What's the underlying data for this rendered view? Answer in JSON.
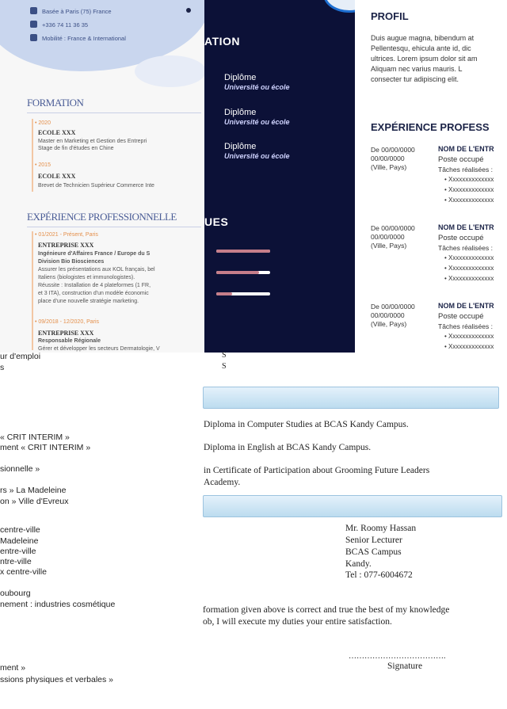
{
  "left_cv": {
    "contacts": [
      "Basée à Paris (75) France",
      "+336 74 11 36 35",
      "Mobilité : France & International"
    ],
    "formation_title": "FORMATION",
    "formation": [
      {
        "date": "• 2020",
        "school": "ECOLE XXX",
        "lines": [
          "Master en Marketing et Gestion des Entrepri",
          "Stage de fin d'études en Chine"
        ]
      },
      {
        "date": "• 2015",
        "school": "ECOLE XXX",
        "lines": [
          "Brevet de Technicien Supérieur Commerce Inte"
        ]
      }
    ],
    "experience_title": "EXPÉRIENCE PROFESSIONNELLE",
    "experience": [
      {
        "date": "• 01/2021 - Présent, Paris",
        "company": "ENTREPRISE XXX",
        "role": "Ingénieure d'Affaires France / Europe du S",
        "lines": [
          "Division Bio Biosciences",
          "Assurer les présentations aux KOL français, bel",
          "Italiens (biologistes et immunologistes).",
          "Réussite : Installation de 4 plateformes (1 FR,",
          "et 3 ITA), construction d'un modèle économic",
          "place d'une nouvelle stratégie marketing."
        ]
      },
      {
        "date": "• 09/2018 - 12/2020, Paris",
        "company": "ENTREPRISE XXX",
        "role": "Responsable Régionale",
        "lines": [
          "Gérer et développer les secteurs Dermatologie, V"
        ]
      }
    ]
  },
  "dark_panel": {
    "formation_title": "ATION",
    "diplomas": [
      {
        "title": "Diplôme",
        "school": "Université ou école"
      },
      {
        "title": "Diplôme",
        "school": "Université ou école"
      },
      {
        "title": "Diplôme",
        "school": "Université ou école"
      }
    ],
    "skills_title": "UES",
    "skill_levels": [
      1.0,
      0.8,
      0.3
    ]
  },
  "right_cv": {
    "profil_title": "PROFIL",
    "profil_lines": [
      "Duis augue magna, bibendum at",
      "Pellentesqu, ehicula ante id, dic",
      "ultrices. Lorem ipsum dolor sit am",
      "Aliquam nec varius mauris. L",
      "consecter tur adipiscing elit."
    ],
    "experience_title": "EXPÉRIENCE PROFESS",
    "jobs": [
      {
        "dates": [
          "De 00/00/0000",
          "00/00/0000",
          "(Ville, Pays)"
        ],
        "company": "NOM DE L'ENTR",
        "post": "Poste occupé",
        "tasks": "Tâches réalisées :",
        "bullets": [
          "• Xxxxxxxxxxxxxx",
          "• Xxxxxxxxxxxxxx",
          "• Xxxxxxxxxxxxxx"
        ]
      },
      {
        "dates": [
          "De 00/00/0000",
          "00/00/0000",
          "(Ville, Pays)"
        ],
        "company": "NOM DE L'ENTR",
        "post": "Poste occupé",
        "tasks": "Tâches réalisées :",
        "bullets": [
          "• Xxxxxxxxxxxxxx",
          "• Xxxxxxxxxxxxxx",
          "• Xxxxxxxxxxxxxx"
        ]
      },
      {
        "dates": [
          "De 00/00/0000",
          "00/00/0000",
          "(Ville, Pays)"
        ],
        "company": "NOM DE L'ENTR",
        "post": "Poste occupé",
        "tasks": "Tâches réalisées :",
        "bullets": [
          "• Xxxxxxxxxxxxxx",
          "• Xxxxxxxxxxxxxx"
        ]
      }
    ]
  },
  "bottom_left": {
    "lines": [
      "ur d'emploi",
      "s",
      "« CRIT INTERIM »",
      "ment « CRIT INTERIM »",
      "sionnelle »",
      "rs » La Madeleine",
      "on » Ville d'Evreux",
      "centre-ville",
      "Madeleine",
      "entre-ville",
      "ntre-ville",
      "x centre-ville",
      "oubourg",
      "nement : industries cosmétique",
      "ment »",
      "ssions physiques et verbales »"
    ]
  },
  "bottom_mid": {
    "s_letters": [
      "S",
      "S"
    ],
    "education": [
      "Diploma in Computer Studies at BCAS Kandy Campus.",
      "Diploma in English at BCAS Kandy Campus.",
      "in Certificate of Participation about Grooming Future Leaders",
      "Academy."
    ],
    "referee": [
      "Mr. Roomy Hassan",
      "Senior Lecturer",
      "BCAS  Campus",
      "Kandy.",
      "Tel : 077-6004672"
    ],
    "declaration": [
      "formation given above is correct and true the best of my knowledge",
      "ob, I will execute my duties your entire satisfaction."
    ],
    "dots": "……………………………….",
    "signature": "Signature"
  }
}
